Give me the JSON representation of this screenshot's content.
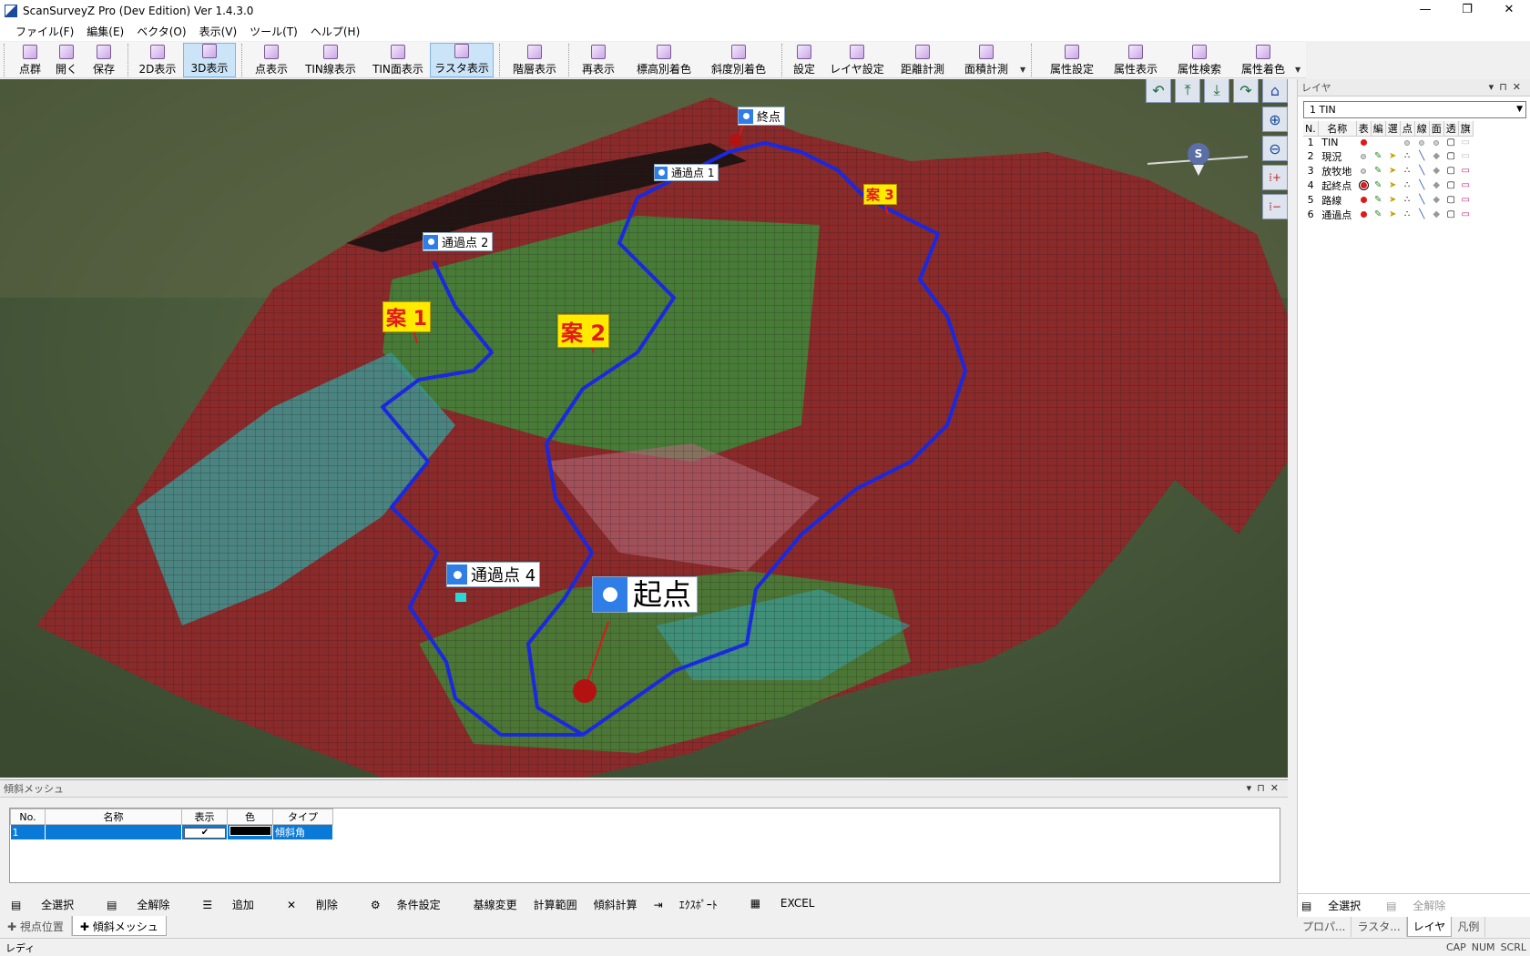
{
  "window": {
    "title": "ScanSurveyZ Pro  (Dev Edition)  Ver 1.4.3.0",
    "min": "—",
    "restore": "❐",
    "close": "✕"
  },
  "menu": [
    "ファイル(F)",
    "編集(E)",
    "ベクタ(O)",
    "表示(V)",
    "ツール(T)",
    "ヘルプ(H)"
  ],
  "toolbar": {
    "point_cloud": "点群",
    "open": "開く",
    "save": "保存",
    "view2d": "2D表示",
    "view3d": "3D表示",
    "point_view": "点表示",
    "tin_line": "TIN線表示",
    "tin_face": "TIN面表示",
    "raster": "ラスタ表示",
    "layer_view": "階層表示",
    "redraw": "再表示",
    "elev_color": "標高別着色",
    "slope_color": "斜度別着色",
    "settings": "設定",
    "layer_settings": "レイヤ設定",
    "distance": "距離計測",
    "area": "面積計測",
    "attr_settings": "属性設定",
    "attr_view": "属性表示",
    "attr_search": "属性検索",
    "attr_color": "属性着色"
  },
  "viewport": {
    "labels": {
      "end": "終点",
      "start": "起点",
      "waypoint1": "通過点 1",
      "waypoint2": "通過点 2",
      "waypoint4": "通過点 4",
      "plan1": "案 1",
      "plan2": "案 2",
      "plan3": "案 3"
    },
    "compass": "S",
    "colors": {
      "route": "#1a28e0",
      "mesh_red": "#8a2a2a",
      "mesh_green": "#3c8a3a",
      "mesh_teal": "#3a9a96",
      "pin": "#2f7ee8"
    }
  },
  "layer_panel": {
    "title": "レイヤ",
    "selected": "1 TIN",
    "columns": [
      "N.",
      "名称",
      "表",
      "編",
      "選",
      "点",
      "線",
      "面",
      "透",
      "旗"
    ],
    "rows": [
      {
        "n": "1",
        "name": "TIN"
      },
      {
        "n": "2",
        "name": "現況"
      },
      {
        "n": "3",
        "name": "放牧地"
      },
      {
        "n": "4",
        "name": "起終点"
      },
      {
        "n": "5",
        "name": "路線"
      },
      {
        "n": "6",
        "name": "通過点"
      }
    ],
    "select_all": "全選択",
    "deselect_all": "全解除"
  },
  "right_tabs": [
    "プロパ...",
    "ラスタ...",
    "レイヤ",
    "凡例"
  ],
  "mesh_panel": {
    "title": "傾斜メッシュ",
    "columns": [
      "No.",
      "名称",
      "表示",
      "色",
      "タイプ"
    ],
    "row": {
      "no": "1",
      "name": "",
      "visible": "✔",
      "type": "傾斜角"
    },
    "buttons": [
      "全選択",
      "全解除",
      "追加",
      "削除",
      "条件設定",
      "基線変更",
      "計算範囲",
      "傾斜計算",
      "ｴｸｽﾎﾟｰﾄ",
      "EXCEL"
    ]
  },
  "bottom_tabs": [
    "視点位置",
    "傾斜メッシュ"
  ],
  "status": {
    "left": "レディ",
    "cap": "CAP",
    "num": "NUM",
    "scrl": "SCRL"
  }
}
